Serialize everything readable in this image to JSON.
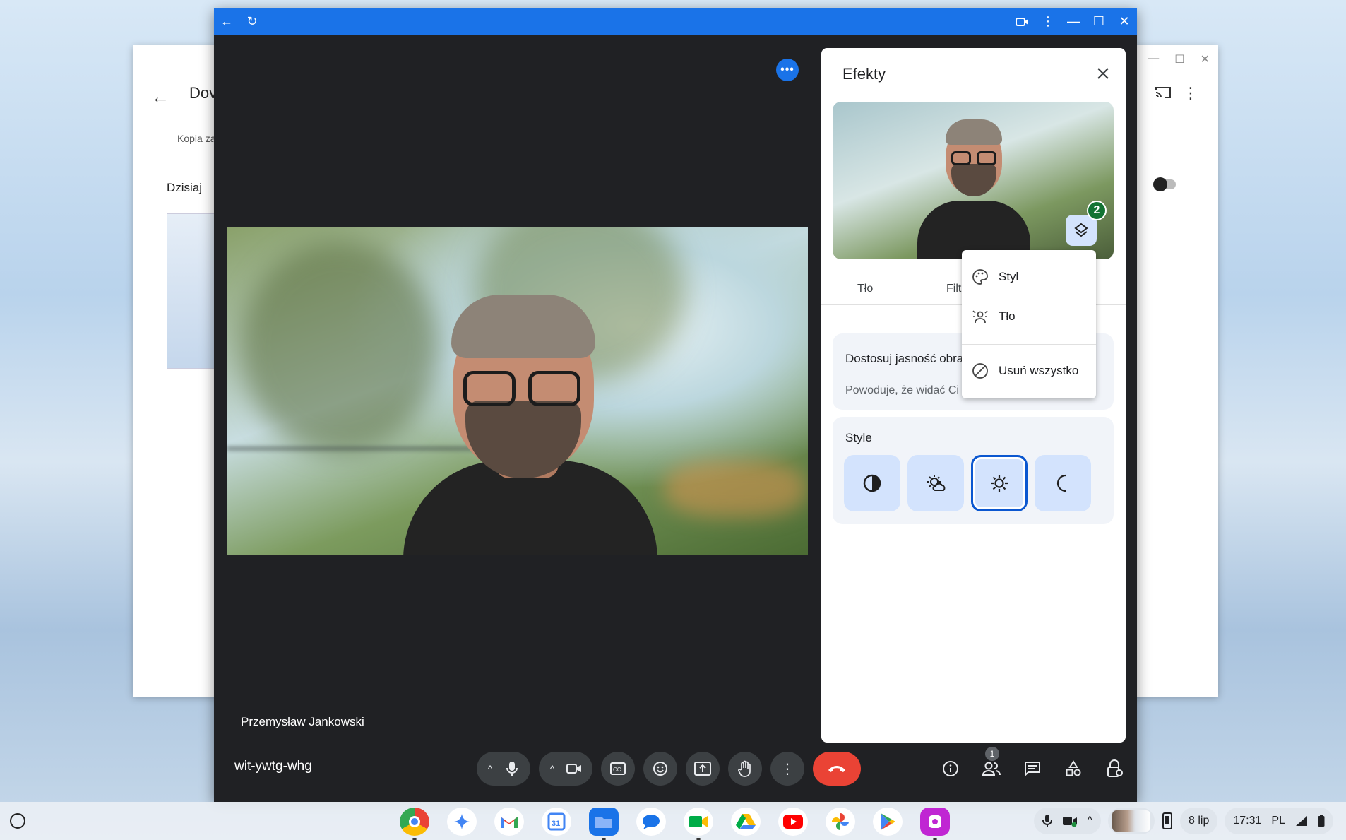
{
  "background_window": {
    "title": "Dov",
    "subtitle": "Kopia za",
    "section": "Dzisiaj"
  },
  "meet": {
    "participant_name": "Przemysław Jankowski",
    "meeting_code": "wit-ywtg-whg",
    "participants_count": "1"
  },
  "effects": {
    "title": "Efekty",
    "layers_count": "2",
    "tabs": [
      "Tło",
      "Filt"
    ],
    "brightness_card": {
      "title": "Dostosuj jasność obra",
      "description": "Powoduje, że widać Ci"
    },
    "style_section": {
      "title": "Style",
      "selected_index": 2
    }
  },
  "menu": {
    "items": [
      {
        "label": "Styl",
        "icon": "palette-icon"
      },
      {
        "label": "Tło",
        "icon": "background-icon"
      },
      {
        "label": "Usuń wszystko",
        "icon": "block-icon"
      }
    ]
  },
  "shelf": {
    "date": "8 lip",
    "time": "17:31",
    "locale": "PL",
    "apps": [
      "chrome",
      "gemini",
      "gmail",
      "calendar",
      "files",
      "messages",
      "meet",
      "drive",
      "youtube",
      "photos",
      "play-store",
      "screencast"
    ]
  },
  "colors": {
    "titlebar": "#1a73e8",
    "meet_bg": "#202124",
    "end_call": "#ea4335",
    "accent": "#0b57d0"
  }
}
